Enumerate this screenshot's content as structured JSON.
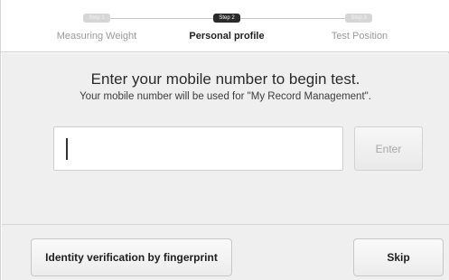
{
  "steps": [
    {
      "badge": "Step 1",
      "label": "Measuring Weight",
      "state": "inactive"
    },
    {
      "badge": "Step 2",
      "label": "Personal profile",
      "state": "active"
    },
    {
      "badge": "Step 3",
      "label": "Test Position",
      "state": "inactive"
    }
  ],
  "prompt": {
    "headline": "Enter your mobile number to begin test.",
    "subline": "Your mobile number will be used for \"My Record Management\"."
  },
  "phone_input": {
    "value": "",
    "placeholder": ""
  },
  "buttons": {
    "enter": "Enter",
    "fingerprint": "Identity verification by fingerprint",
    "skip": "Skip"
  },
  "colors": {
    "active_step": "#2a2a2a",
    "inactive_step": "#d6d6d6",
    "panel_bg": "#efefef"
  }
}
